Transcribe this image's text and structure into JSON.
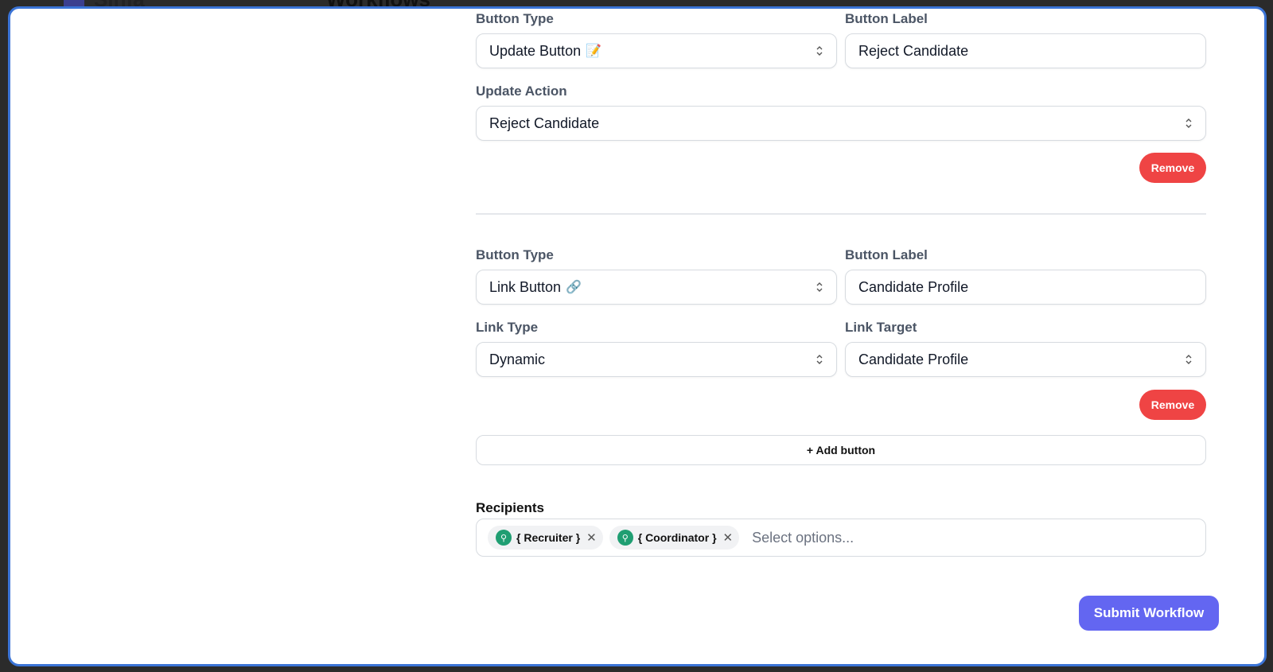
{
  "background": {
    "brand": "Sinfa",
    "heading": "Workflows"
  },
  "button1": {
    "type_label": "Button Type",
    "type_value": "Update Button",
    "type_emoji": "📝",
    "label_label": "Button Label",
    "label_value": "Reject Candidate",
    "action_label": "Update Action",
    "action_value": "Reject Candidate",
    "remove": "Remove"
  },
  "button2": {
    "type_label": "Button Type",
    "type_value": "Link Button",
    "type_emoji": "🔗",
    "label_label": "Button Label",
    "label_value": "Candidate Profile",
    "link_type_label": "Link Type",
    "link_type_value": "Dynamic",
    "link_target_label": "Link Target",
    "link_target_value": "Candidate Profile",
    "remove": "Remove"
  },
  "add_button": "+ Add button",
  "recipients": {
    "label": "Recipients",
    "chips": [
      "{ Recruiter }",
      "{ Coordinator }"
    ],
    "placeholder": "Select options..."
  },
  "submit": "Submit Workflow",
  "colors": {
    "remove": "#ef4444",
    "submit": "#6366f1",
    "chip_dot": "#1f9e72",
    "modal_border": "#3b74d6"
  }
}
